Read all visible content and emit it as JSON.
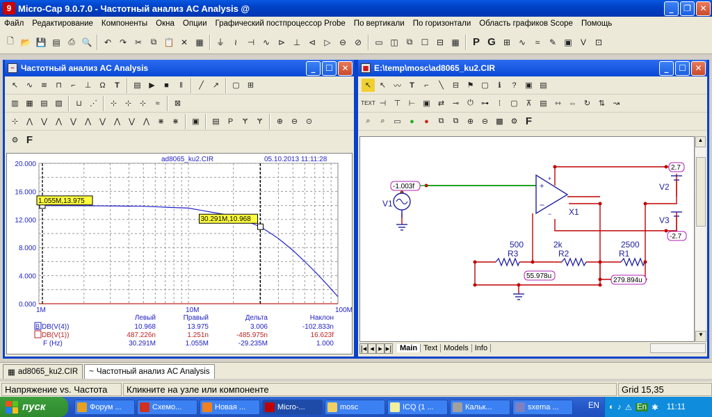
{
  "app": {
    "title": "Micro-Cap 9.0.7.0 - Частотный анализ AC Analysis @",
    "icon": "9"
  },
  "menu": [
    "Файл",
    "Редактирование",
    "Компоненты",
    "Окна",
    "Опции",
    "Графический постпроцессор Probe",
    "По вертикали",
    "По горизонтали",
    "Область графиков Scope",
    "Помощь"
  ],
  "analysis_window": {
    "title": "Частотный анализ AC Analysis",
    "plot_header": {
      "file": "ad8065_ku2.CIR",
      "date": "05.10.2013 11:11:28"
    },
    "markers": {
      "left": "1.055M,13.975",
      "right": "30.291M,10.968"
    },
    "table": {
      "headers": [
        "Левый",
        "Правый",
        "Дельта",
        "Наклон"
      ],
      "rows": [
        {
          "tag": "B",
          "name": "DB(V(4))",
          "vals": [
            "10.968",
            "13.975",
            "3.006",
            "-102.833n"
          ],
          "color": "#2020c8"
        },
        {
          "tag": "",
          "name": "DB(V(1))",
          "vals": [
            "487.226n",
            "1.251n",
            "-485.975n",
            "16.623f"
          ],
          "color": "#c02020"
        },
        {
          "tag": "",
          "name": "F (Hz)",
          "vals": [
            "30.291M",
            "1.055M",
            "-29.235M",
            "1.000"
          ],
          "color": "#2020c8"
        }
      ]
    }
  },
  "chart_data": {
    "type": "line",
    "title": "",
    "xscale": "log",
    "xlim": [
      1000000,
      100000000
    ],
    "ylim": [
      0,
      20
    ],
    "xticks": [
      "1M",
      "10M",
      "100M"
    ],
    "yticks": [
      "20.000",
      "16.000",
      "12.000",
      "8.000",
      "4.000",
      "0.000"
    ],
    "series": [
      {
        "name": "DB(V(4))",
        "color": "#2020c8",
        "x": [
          1000000,
          2000000,
          5000000,
          10000000,
          20000000,
          30291000,
          40000000,
          50000000,
          60000000,
          70000000,
          80000000,
          90000000,
          100000000
        ],
        "y": [
          13.98,
          13.96,
          13.88,
          13.62,
          12.5,
          10.97,
          9.3,
          7.6,
          6.0,
          4.6,
          3.3,
          2.1,
          1.0
        ]
      },
      {
        "name": "DB(V(1))",
        "color": "#c02020",
        "x": [
          1000000,
          100000000
        ],
        "y": [
          0,
          0
        ]
      }
    ],
    "cursors": [
      {
        "x": 1055000,
        "y": 13.975
      },
      {
        "x": 30291000,
        "y": 10.968
      }
    ]
  },
  "schematic_window": {
    "title": "E:\\temp\\mosc\\ad8065_ku2.CIR",
    "labels": {
      "v_in": "-1.003f",
      "v1": "V1",
      "x1": "X1",
      "v2": "V2",
      "v3": "V3",
      "v2val": "2.7",
      "v3val": "-2.7",
      "r3": "R3",
      "r3val": "500",
      "r2": "R2",
      "r2val": "2k",
      "r1": "R1",
      "r1val": "2500",
      "node1": "55.978u",
      "node2": "279.894u"
    },
    "tabs": [
      "Main",
      "Text",
      "Models",
      "Info"
    ]
  },
  "bottom_tabs": [
    "ad8065_ku2.CIR",
    "Частотный анализ AC Analysis"
  ],
  "status": {
    "left": "Напряжение vs. Частота",
    "middle": "Кликните на узле или компоненте",
    "right": "Grid 15,35"
  },
  "taskbar": {
    "start": "пуск",
    "items": [
      {
        "label": "Форум ...",
        "color": "#e8a020"
      },
      {
        "label": "Схемо...",
        "color": "#d03020"
      },
      {
        "label": "Новая ...",
        "color": "#f08020"
      },
      {
        "label": "Micro-...",
        "color": "#c00000"
      },
      {
        "label": "mosc",
        "color": "#f0d060"
      },
      {
        "label": "ICQ (1 ...",
        "color": "#f0f0a0"
      },
      {
        "label": "Кальк...",
        "color": "#a0a0a0"
      },
      {
        "label": "sxema ...",
        "color": "#8080c0"
      }
    ],
    "lang": "EN",
    "tray_lang": "En",
    "time": "11:11"
  }
}
